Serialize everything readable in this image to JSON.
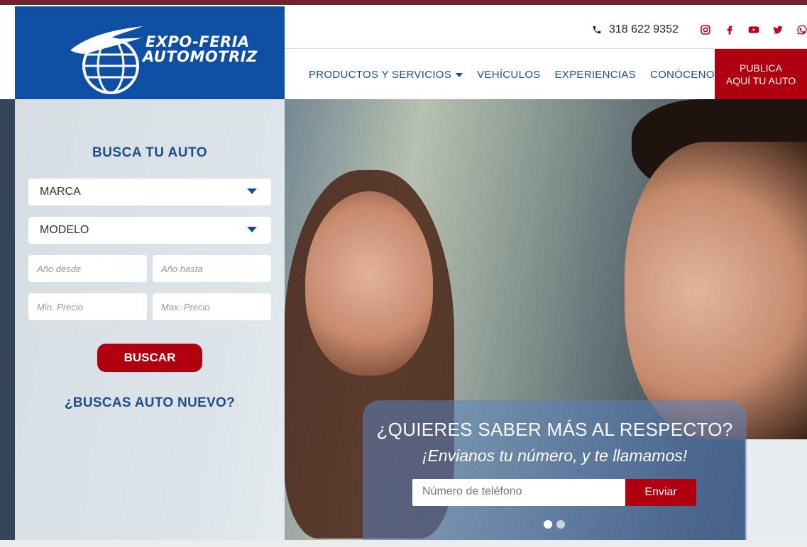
{
  "brand": {
    "line1": "EXPO-FERIA",
    "line2": "AUTOMOTRIZ"
  },
  "contact": {
    "phone": "318 622 9352"
  },
  "socials": [
    {
      "icon": "instagram-icon"
    },
    {
      "icon": "facebook-icon"
    },
    {
      "icon": "youtube-icon"
    },
    {
      "icon": "twitter-icon"
    },
    {
      "icon": "whatsapp-icon"
    }
  ],
  "nav": {
    "items": [
      {
        "label": "PRODUCTOS Y SERVICIOS",
        "has_dropdown": true
      },
      {
        "label": "VEHÍCULOS"
      },
      {
        "label": "EXPERIENCIAS"
      },
      {
        "label": "CONÓCENOS"
      }
    ],
    "publica": {
      "line1": "PUBLICA",
      "line2": "AQUÍ TU AUTO"
    }
  },
  "search": {
    "title": "BUSCA TU AUTO",
    "marca": "MARCA",
    "modelo": "MODELO",
    "year_from": "Año desde",
    "year_to": "Año hasta",
    "price_min": "Min. Precio",
    "price_max": "Max. Precio",
    "button": "BUSCAR",
    "new_link": "¿BUSCAS AUTO NUEVO?"
  },
  "cta": {
    "title": "¿QUIERES SABER MÁS AL RESPECTO?",
    "subtitle": "¡Envianos tu número, y te llamamos!",
    "phone_placeholder": "Número de teléfono",
    "button": "Enviar"
  },
  "colors": {
    "brand_blue": "#0f4fa3",
    "nav_blue": "#1d4e8c",
    "accent_red": "#b00010"
  }
}
